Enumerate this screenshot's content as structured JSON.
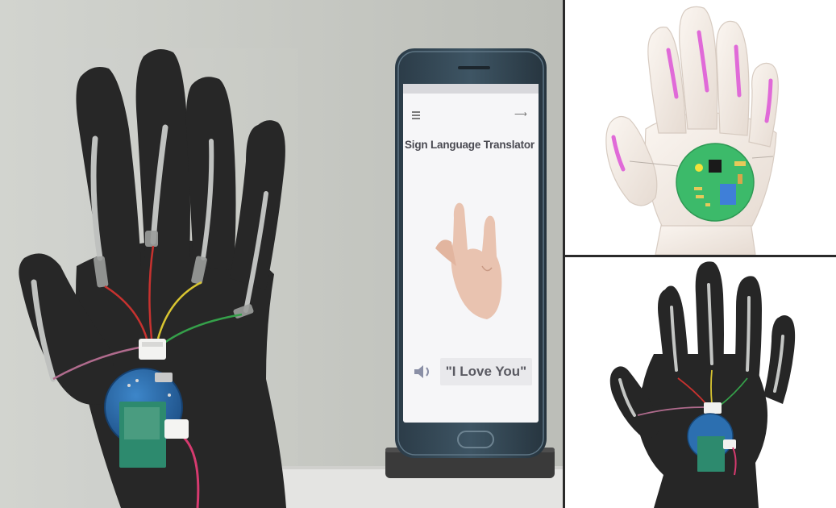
{
  "colors": {
    "glove": "#222222",
    "sensor_strip": "#bdbfbd",
    "pcb_blue": "#2c6fb0",
    "render_hand": "#f2ebe4",
    "render_sensor": "#e06ad8",
    "render_pcb": "#3cba6a",
    "phone_screen": "#f6f6f8"
  },
  "phone_app": {
    "title": "Sign Language Translator",
    "result_text": "\"I Love You\"",
    "menu_icon": "hamburger-menu-icon",
    "nav_icon": "arrow-right-icon",
    "audio_icon": "speaker-icon"
  }
}
